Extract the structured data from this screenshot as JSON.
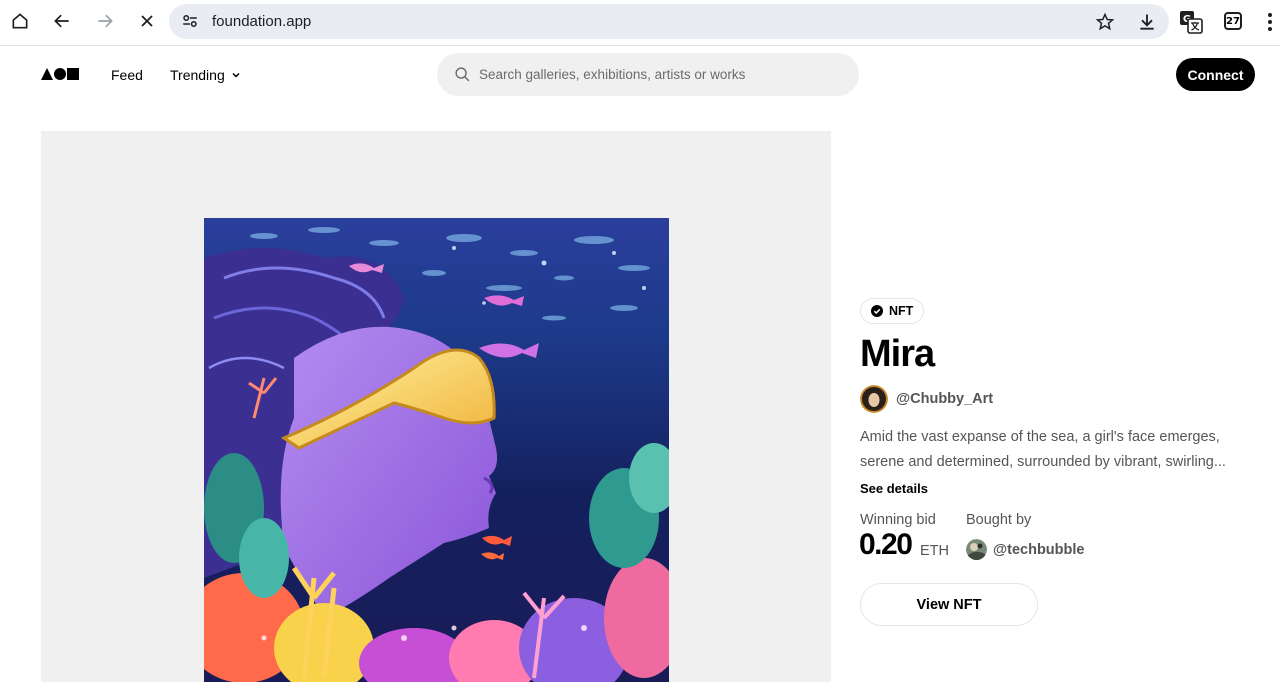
{
  "browser": {
    "url": "foundation.app",
    "tab_count": "27",
    "icons": [
      "home-icon",
      "back-icon",
      "forward-icon",
      "stop-loading-icon",
      "site-settings-icon",
      "bookmark-star-icon",
      "download-icon",
      "translate-icon",
      "tab-count-icon",
      "menu-dots-icon"
    ]
  },
  "header": {
    "nav": {
      "feed": "Feed",
      "trending": "Trending"
    },
    "search": {
      "placeholder": "Search galleries, exhibitions, artists or works"
    },
    "connect_label": "Connect"
  },
  "artwork": {
    "badge": "NFT",
    "title": "Mira",
    "creator": "@Chubby_Art",
    "description": "Amid the vast expanse of the sea, a girl's face emerges, serene and determined, surrounded by vibrant, swirling...",
    "see_details": "See details",
    "winning_bid_label": "Winning bid",
    "winning_bid_amount": "0.20",
    "winning_bid_unit": "ETH",
    "bought_by_label": "Bought by",
    "buyer": "@techbubble",
    "view_nft_label": "View NFT"
  },
  "colors": {
    "accent": "#000000",
    "panel_bg": "#f0f0f0",
    "urlbar_bg": "#e9edf3",
    "muted_text": "#555555"
  }
}
